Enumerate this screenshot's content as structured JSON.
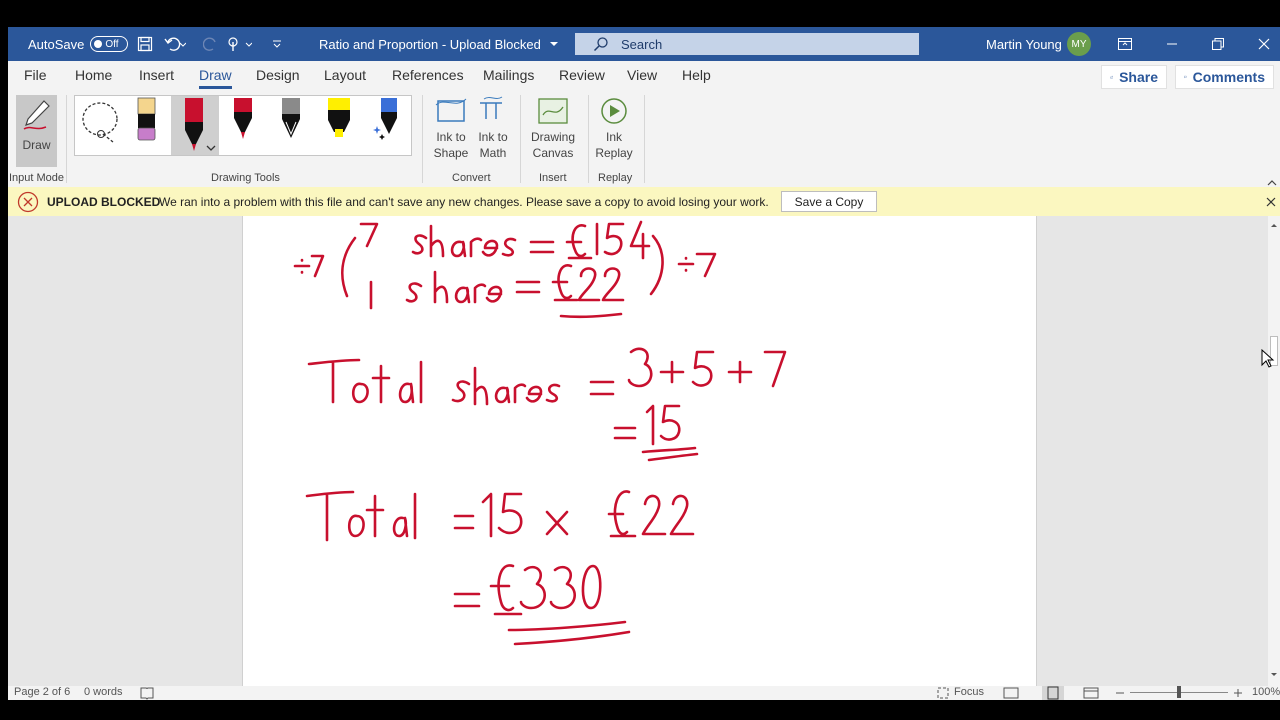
{
  "titlebar": {
    "autosave_label": "AutoSave",
    "autosave_state": "Off",
    "doc_title": "Ratio and Proportion  -  Upload Blocked",
    "search_placeholder": "Search",
    "user_name": "Martin Young",
    "user_initials": "MY"
  },
  "tabs": [
    "File",
    "Home",
    "Insert",
    "Draw",
    "Design",
    "Layout",
    "References",
    "Mailings",
    "Review",
    "View",
    "Help"
  ],
  "active_tab": "Draw",
  "share_label": "Share",
  "comments_label": "Comments",
  "ribbon": {
    "draw_label": "Draw",
    "input_mode_label": "Input Mode",
    "drawing_tools_label": "Drawing Tools",
    "ink_to_shape": [
      "Ink to",
      "Shape"
    ],
    "ink_to_math": [
      "Ink to",
      "Math"
    ],
    "convert_label": "Convert",
    "drawing_canvas": [
      "Drawing",
      "Canvas"
    ],
    "insert_label": "Insert",
    "ink_replay": [
      "Ink",
      "Replay"
    ],
    "replay_label": "Replay"
  },
  "message_bar": {
    "title": "UPLOAD BLOCKED",
    "text": "We ran into a problem with this file and can't save any new changes. Please save a copy to avoid losing your work.",
    "button": "Save a Copy"
  },
  "status": {
    "page": "Page 2 of 6",
    "words": "0 words",
    "focus": "Focus",
    "zoom": "100%"
  },
  "colors": {
    "brand": "#2b579a",
    "ink": "#c8102e",
    "warning_bg": "#fbf7c0",
    "error": "#c0392b"
  }
}
